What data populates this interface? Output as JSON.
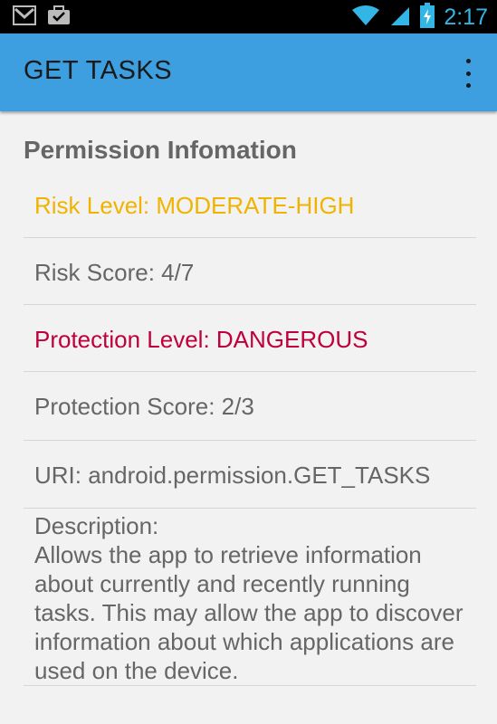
{
  "status_bar": {
    "time": "2:17",
    "icons": [
      "gmail-icon",
      "briefcase-icon",
      "wifi-icon",
      "signal-icon",
      "battery-charging-icon"
    ]
  },
  "app_bar": {
    "title": "GET TASKS",
    "overflow_icon": "more-vert-icon"
  },
  "permission": {
    "header": "Permission Infomation",
    "risk_level": "Risk Level: MODERATE-HIGH",
    "risk_score": "Risk Score: 4/7",
    "protection_level": "Protection Level: DANGEROUS",
    "protection_score": "Protection Score: 2/3",
    "uri": "URI: android.permission.GET_TASKS",
    "description_label": "Description:",
    "description": "Allows the app to retrieve information about currently and recently running tasks. This may allow the app to discover information about which applications are used on the device."
  },
  "colors": {
    "app_bar": "#3d9ee0",
    "risk_level": "#f0b400",
    "protection_level": "#c0003c",
    "text": "#666666",
    "clock": "#33b5e5"
  }
}
